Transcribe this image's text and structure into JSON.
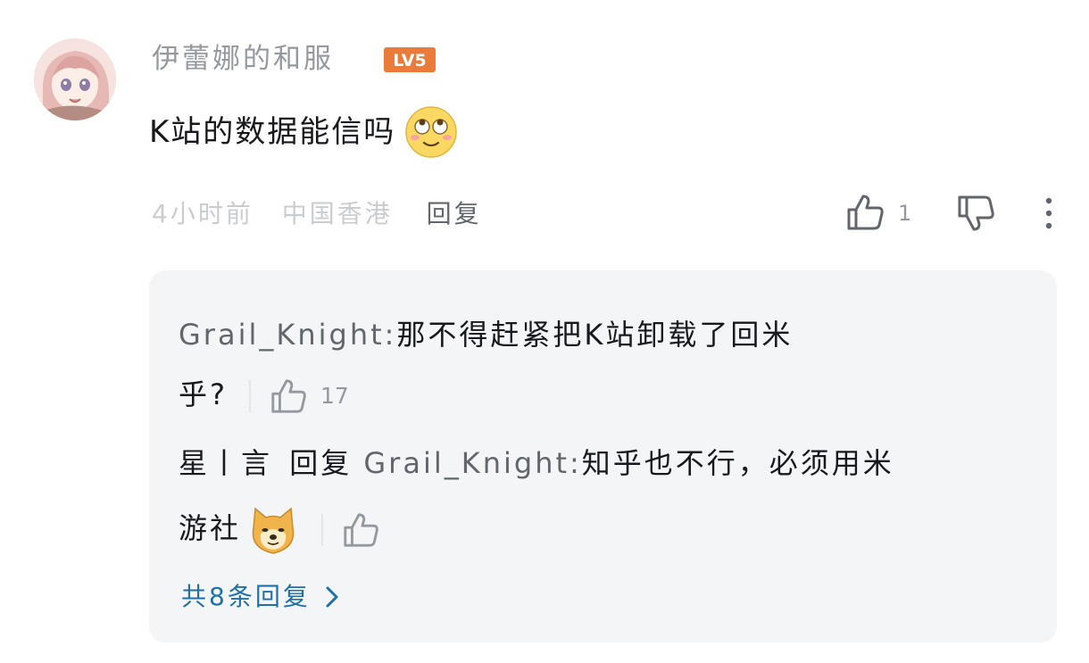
{
  "comment": {
    "username": "伊蕾娜的和服",
    "level_badge": "LV5",
    "text": "K站的数据能信吗",
    "emoji": "roll-eyes-emoji",
    "time": "4小时前",
    "location": "中国香港",
    "reply_label": "回复",
    "like_count": "1"
  },
  "replies": {
    "items": [
      {
        "user": "Grail_Knight:",
        "text_line1": "那不得赶紧把K站卸载了回米",
        "text_line2": "乎?",
        "like_count": "17"
      },
      {
        "user": "星丨言",
        "reply_word": "回复",
        "reply_to": "Grail_Knight:",
        "text_line1": "知乎也不行，必须用米",
        "text_line2": "游社",
        "emoji": "doge-emoji",
        "like_count": ""
      }
    ],
    "total_label": "共8条回复"
  },
  "colors": {
    "badge": "#e97b3b",
    "accent_link": "#1f6fa8",
    "muted": "#9499a0",
    "panel_bg": "#f4f5f7"
  }
}
